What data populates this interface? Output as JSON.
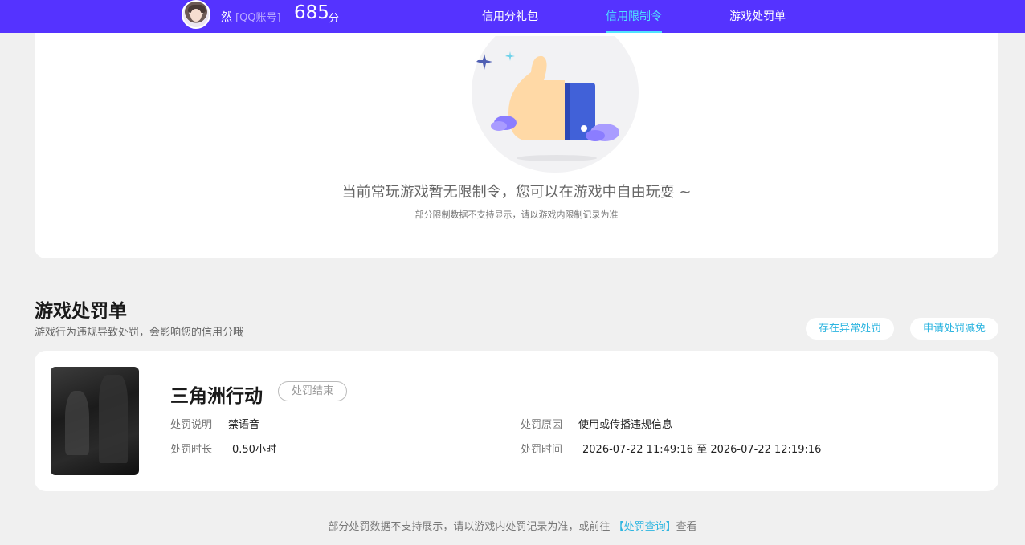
{
  "header": {
    "user_name": "然",
    "account_type": "[QQ账号]",
    "score": "685",
    "score_unit": "分",
    "tabs": [
      {
        "label": "信用分礼包",
        "active": false
      },
      {
        "label": "信用限制令",
        "active": true
      },
      {
        "label": "游戏处罚单",
        "active": false
      }
    ]
  },
  "restriction": {
    "empty_title": "当前常玩游戏暂无限制令，您可以在游戏中自由玩耍 ~",
    "empty_subtitle": "部分限制数据不支持显示，请以游戏内限制记录为准"
  },
  "penalty_section": {
    "title": "游戏处罚单",
    "subtitle": "游戏行为违规导致处罚，会影响您的信用分哦",
    "abnormal_button": "存在异常处罚",
    "reduce_button": "申请处罚减免"
  },
  "penalty": {
    "game_name": "三角洲行动",
    "status": "处罚结束",
    "desc_label": "处罚说明",
    "desc_value": "禁语音",
    "duration_label": "处罚时长",
    "duration_value": "0.50小时",
    "reason_label": "处罚原因",
    "reason_value": "使用或传播违规信息",
    "time_label": "处罚时间",
    "time_value": "2026-07-22 11:49:16 至 2026-07-22 12:19:16"
  },
  "footer": {
    "note_prefix": "部分处罚数据不支持展示，请以游戏内处罚记录为准，或前往",
    "link_text": "【处罚查询】",
    "note_suffix": "查看"
  },
  "colors": {
    "nav_bg": "#5533ff",
    "active_tab": "#4fe3ff",
    "link": "#2db5e0"
  }
}
